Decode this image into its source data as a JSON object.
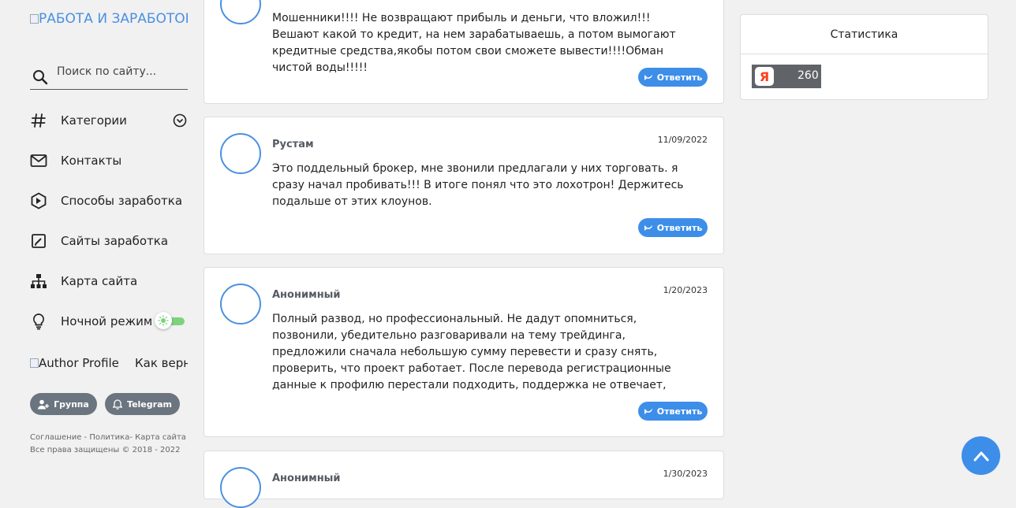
{
  "sidebar": {
    "logo_alt": "РАБОТА И ЗАРАБОТОК",
    "search_placeholder": "Поиск по сайту...",
    "nav": [
      {
        "label": "Категории"
      },
      {
        "label": "Контакты"
      },
      {
        "label": "Способы заработка"
      },
      {
        "label": "Сайты заработка"
      },
      {
        "label": "Карта сайта"
      },
      {
        "label": "Ночной режим"
      }
    ],
    "author_alt": "Author Profile",
    "author_teaser": "Как верн",
    "buttons": {
      "group": "Группа",
      "telegram": "Telegram"
    },
    "footer_links": "Соглашение - Политика- Карта сайта",
    "copyright": "Все права защищены © 2018 - 2022"
  },
  "comments": [
    {
      "text": "Мошенники!!!! Не возвращают прибыль и деньги, что вложил!!! Вешают какой то кредит, на нем зарабатываешь, а потом вымогают кредитные средства,якобы потом свои сможете вывести!!!!Обман чистой воды!!!!!",
      "reply": "Ответить"
    },
    {
      "author": "Рустам",
      "date": "11/09/2022",
      "text": "Это поддельный брокер, мне звонили предлагали у них торговать. я сразу начал пробивать!!! В итоге понял что это лохотрон! Держитесь подальше от этих клоунов.",
      "reply": "Ответить"
    },
    {
      "author": "Анонимный",
      "date": "1/20/2023",
      "text": "Полный развод, но профессиональный. Не дадут опомниться, позвонили, убедительно разговаривали на тему трейдинга, предложили сначала небольшую сумму перевести и сразу снять, проверить, что проект работает. После перевода регистрационные данные к профилю перестали подходить, поддержка не отвечает, номера с которых звонили - тоже) Мелкие воришки",
      "reply": "Ответить"
    },
    {
      "author": "Анонимный",
      "date": "1/30/2023"
    }
  ],
  "stats": {
    "title": "Статистика",
    "yandex_letter": "Я",
    "counter": "260"
  },
  "colors": {
    "accent": "#3d8ee8",
    "avatar_ring": "#4a90e2",
    "toggle": "#7ed27e",
    "pill": "#6b7580"
  }
}
